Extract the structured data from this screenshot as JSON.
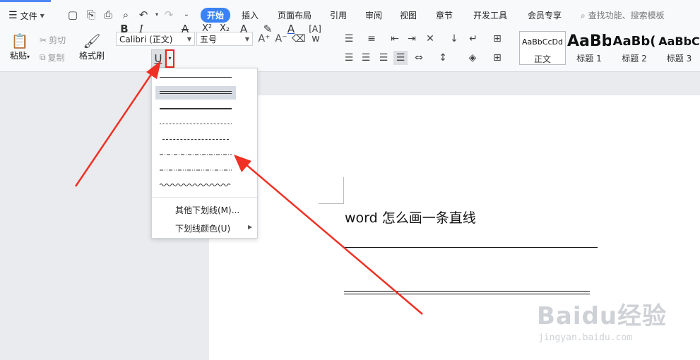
{
  "menubar": {
    "file_label": "文件",
    "tabs": [
      {
        "label": "开始",
        "active": true
      },
      {
        "label": "插入"
      },
      {
        "label": "页面布局"
      },
      {
        "label": "引用"
      },
      {
        "label": "审阅"
      },
      {
        "label": "视图"
      },
      {
        "label": "章节"
      },
      {
        "label": "开发工具"
      },
      {
        "label": "会员专享"
      }
    ],
    "search_placeholder": "查找功能、搜索模板"
  },
  "ribbon": {
    "paste_label": "粘贴",
    "cut_label": "剪切",
    "copy_label": "复制",
    "format_painter_label": "格式刷",
    "font_name": "Calibri (正文)",
    "font_size": "五号",
    "bold": "B",
    "italic": "I",
    "underline": "U",
    "superscript": "X²",
    "subscript": "X₂",
    "styles": [
      {
        "sample": "AaBbCcDd",
        "name": "正文"
      },
      {
        "sample": "AaBb",
        "name": "标题 1"
      },
      {
        "sample": "AaBb(",
        "name": "标题 2"
      },
      {
        "sample": "AaBbC",
        "name": "标题 3"
      }
    ]
  },
  "underline_menu": {
    "options": [
      "single",
      "double",
      "thick",
      "dotted",
      "dashed",
      "dash-dot",
      "dash-dot-dot",
      "wavy"
    ],
    "selected": "double",
    "more_label": "其他下划线(M)...",
    "color_label": "下划线颜色(U)"
  },
  "document": {
    "title": "word 怎么画一条直线"
  },
  "watermark": {
    "main": "Baidu经验",
    "sub": "jingyan.baidu.com"
  },
  "colors": {
    "accent": "#3b82f6",
    "annotation": "#f03024"
  }
}
